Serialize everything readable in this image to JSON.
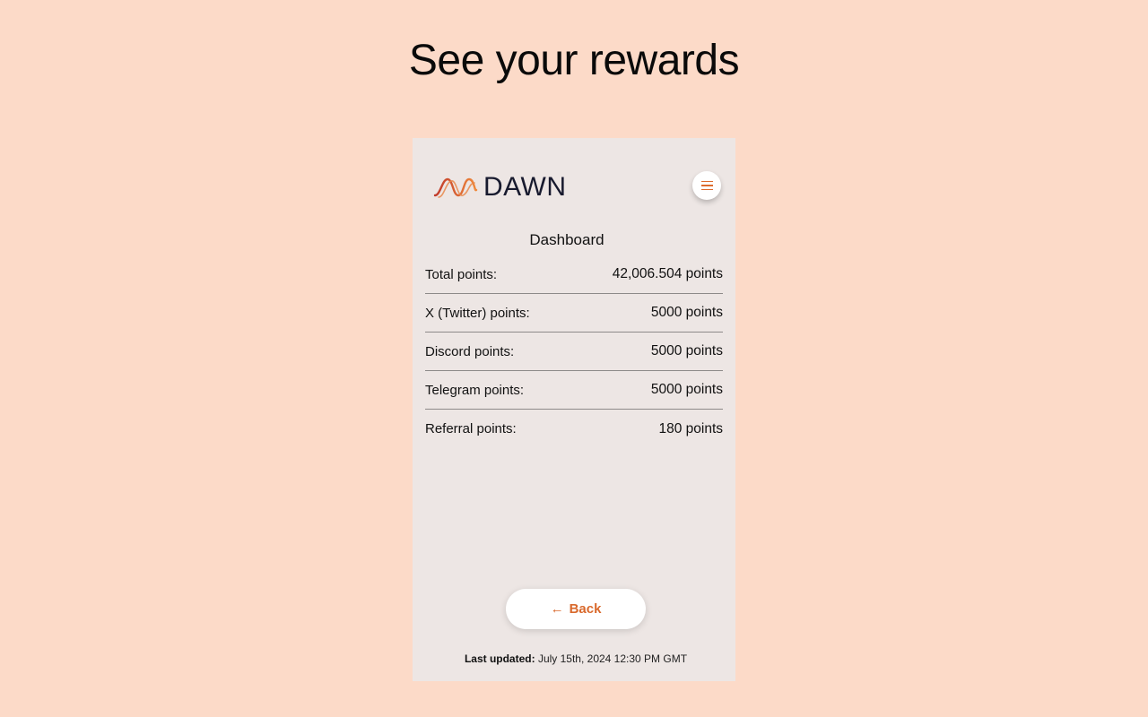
{
  "page": {
    "title": "See your rewards"
  },
  "app": {
    "logo_text": "DAWN",
    "brand_colors": {
      "accent": "#dd6b2e",
      "dark": "#181a2e"
    }
  },
  "dashboard": {
    "title": "Dashboard",
    "rows": [
      {
        "label": "Total points:",
        "value": "42,006.504 points"
      },
      {
        "label": "X (Twitter) points:",
        "value": "5000 points"
      },
      {
        "label": "Discord points:",
        "value": "5000 points"
      },
      {
        "label": "Telegram points:",
        "value": "5000 points"
      },
      {
        "label": "Referral points:",
        "value": "180 points"
      }
    ]
  },
  "back_button": {
    "icon": "arrow-left-icon",
    "label": "Back"
  },
  "footer": {
    "last_updated_label": "Last updated:",
    "last_updated_value": "July 15th, 2024 12:30 PM GMT"
  }
}
